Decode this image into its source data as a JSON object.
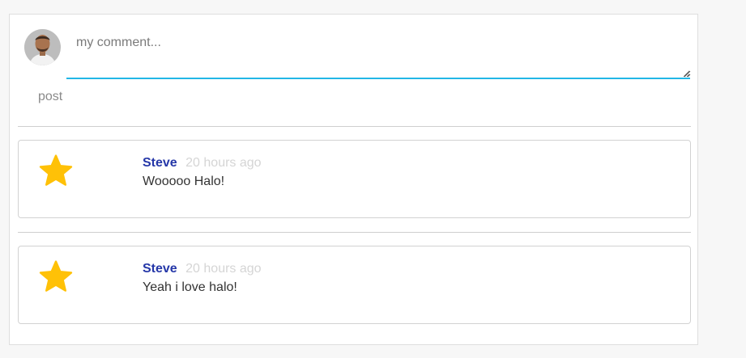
{
  "composer": {
    "placeholder": "my comment...",
    "value": "",
    "post_label": "post"
  },
  "comments": [
    {
      "author": "Steve",
      "time": "20 hours ago",
      "text": "Wooooo Halo!"
    },
    {
      "author": "Steve",
      "time": "20 hours ago",
      "text": "Yeah i love halo!"
    }
  ],
  "icons": {
    "avatar": "user-avatar",
    "star": "star-icon",
    "resize": "resize-grip-icon"
  },
  "colors": {
    "accent": "#22b7e6",
    "author": "#2537a8",
    "star": "#ffc107",
    "timestamp": "#d5d5d5"
  }
}
